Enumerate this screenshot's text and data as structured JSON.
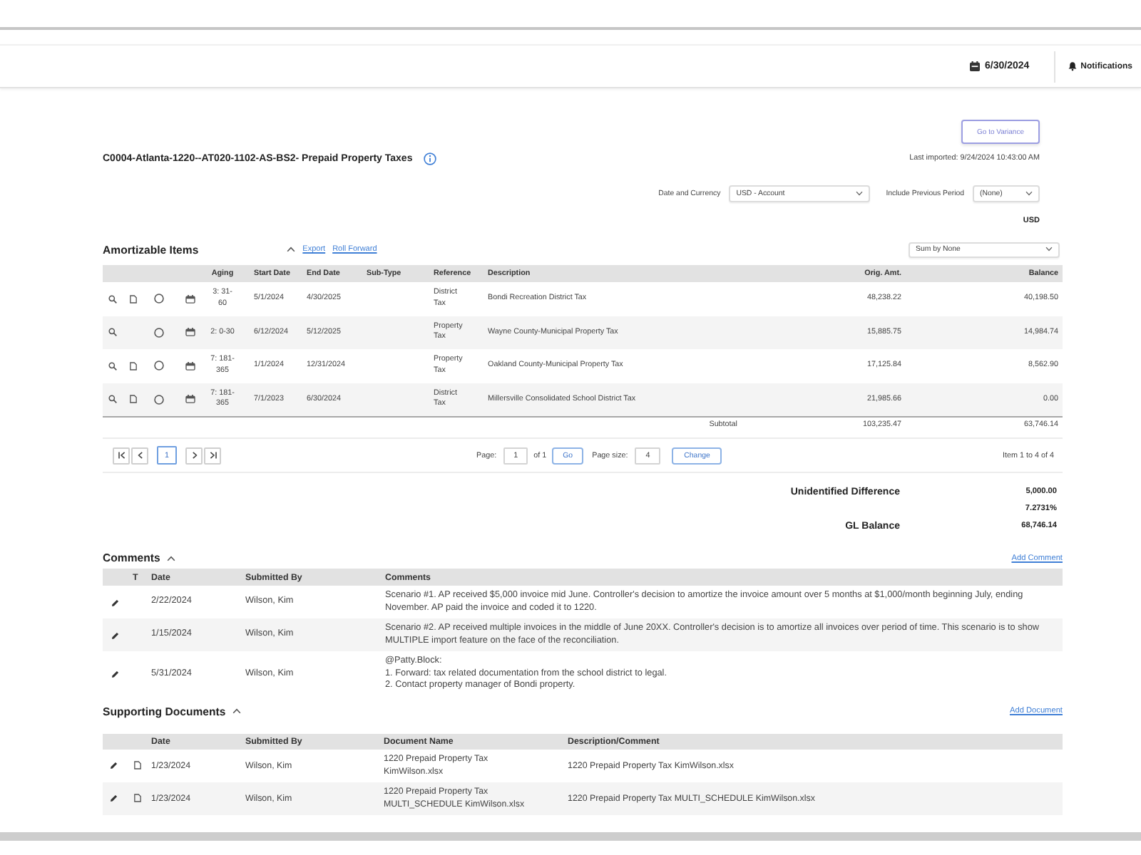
{
  "header": {
    "date": "6/30/2024",
    "notifications": "Notifications"
  },
  "page": {
    "action": "Go to Variance",
    "title": "C0004-Atlanta-1220--AT020-1102-AS-BS2- Prepaid Property Taxes",
    "last_imported": "Last imported: 9/24/2024 10:43:00 AM"
  },
  "filters": [
    {
      "label": "Date and Currency",
      "value": "USD - Account"
    },
    {
      "label": "Include Previous Period",
      "value": "(None)"
    }
  ],
  "currency": "USD",
  "amortizable_items": {
    "title": "Amortizable Items",
    "links": [
      "Export",
      "Roll Forward"
    ],
    "sum_by": "Sum by None",
    "columns": [
      "Aging",
      "Start Date",
      "End Date",
      "Sub-Type",
      "Reference",
      "Description",
      "Orig. Amt.",
      "Balance"
    ],
    "rows": [
      {
        "has_document": true,
        "aging": "3: 31-60",
        "start_date": "5/1/2024",
        "end_date": "4/30/2025",
        "reference": "District Tax",
        "description": "Bondi Recreation District Tax",
        "orig_amt": "48,238.22",
        "balance": "40,198.50"
      },
      {
        "has_document": false,
        "aging": "2: 0-30",
        "start_date": "6/12/2024",
        "end_date": "5/12/2025",
        "reference": "Property Tax",
        "description": "Wayne County-Municipal Property Tax",
        "orig_amt": "15,885.75",
        "balance": "14,984.74"
      },
      {
        "has_document": true,
        "aging": "7: 181-365",
        "start_date": "1/1/2024",
        "end_date": "12/31/2024",
        "reference": "Property Tax",
        "description": "Oakland County-Municipal Property Tax",
        "orig_amt": "17,125.84",
        "balance": "8,562.90"
      },
      {
        "has_document": true,
        "aging": "7: 181-365",
        "start_date": "7/1/2023",
        "end_date": "6/30/2024",
        "reference": "District Tax",
        "description": "Millersville Consolidated School District Tax",
        "orig_amt": "21,985.66",
        "balance": "0.00"
      }
    ],
    "subtotal": {
      "label": "Subtotal",
      "orig_amt": "103,235.47",
      "balance": "63,746.14"
    }
  },
  "pagination": {
    "pages": [
      {
        "label": "1",
        "selected": true
      }
    ],
    "page_label": "Page:",
    "page": "1",
    "of": "of 1",
    "go": "Go",
    "size_label": "Page size:",
    "size": "4",
    "change": "Change",
    "range": "Item 1 to 4 of 4"
  },
  "summary": [
    {
      "label": "Unidentified Difference",
      "value": "5,000.00"
    },
    {
      "value": "7.2731%"
    },
    {
      "label": "GL Balance",
      "value": "68,746.14"
    }
  ],
  "comments": {
    "title": "Comments",
    "action": "Add Comment",
    "columns": [
      "T",
      "Date",
      "Submitted By",
      "Comments"
    ],
    "rows": [
      {
        "date": "2/22/2024",
        "submitted_by": "Wilson, Kim",
        "comment": "Scenario #1. AP received $5,000 invoice mid June. Controller's decision to amortize the invoice amount over 5 months at $1,000/month beginning July, ending November. AP paid the invoice and coded it to 1220."
      },
      {
        "date": "1/15/2024",
        "submitted_by": "Wilson, Kim",
        "comment": "Scenario #2. AP received multiple invoices in the middle of June 20XX. Controller's decision is to amortize all invoices over period of time. This scenario is to show MULTIPLE import feature on the face of the reconciliation."
      },
      {
        "date": "5/31/2024",
        "submitted_by": "Wilson, Kim",
        "comment": "@Patty.Block:\n1. Forward: tax related documentation from the school district to legal.\n2. Contact property manager of Bondi property."
      }
    ]
  },
  "supporting_documents": {
    "title": "Supporting Documents",
    "action": "Add Document",
    "columns": [
      "Date",
      "Submitted By",
      "Document Name",
      "Description/Comment"
    ],
    "rows": [
      {
        "date": "1/23/2024",
        "submitted_by": "Wilson, Kim",
        "document_name": "1220 Prepaid Property Tax KimWilson.xlsx",
        "description": "1220 Prepaid Property Tax KimWilson.xlsx"
      },
      {
        "date": "1/23/2024",
        "submitted_by": "Wilson, Kim",
        "document_name": "1220 Prepaid Property Tax MULTI_SCHEDULE KimWilson.xlsx",
        "description": "1220 Prepaid Property Tax MULTI_SCHEDULE KimWilson.xlsx"
      }
    ]
  }
}
